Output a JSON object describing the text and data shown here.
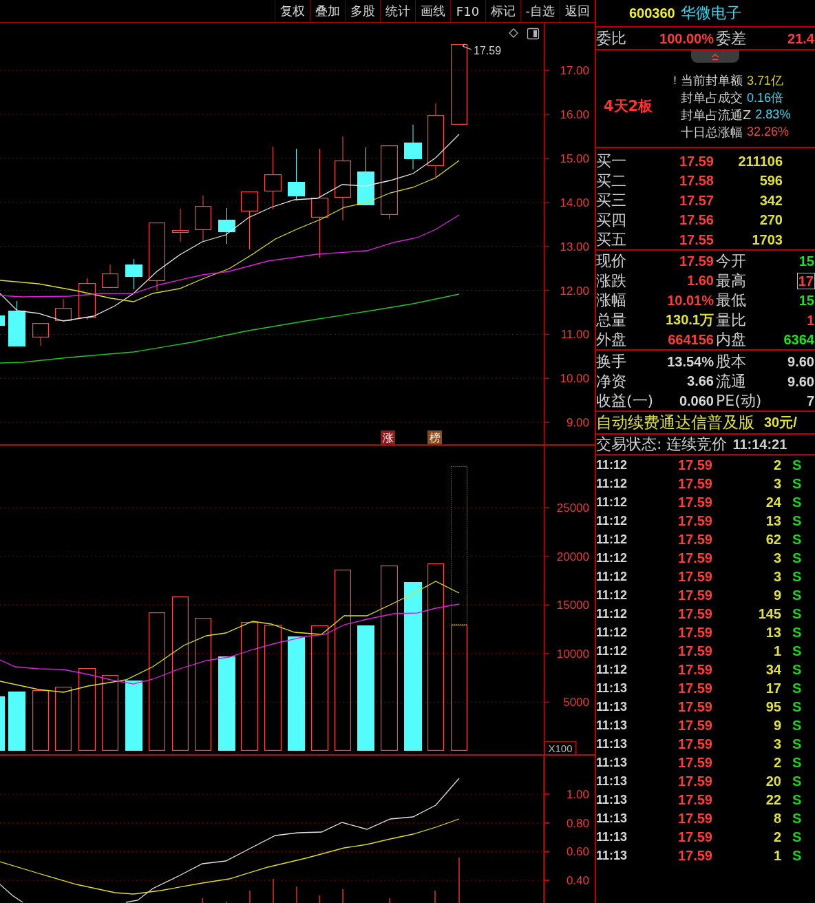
{
  "toolbar": {
    "buttons": [
      "复权",
      "叠加",
      "多股",
      "统计",
      "画线",
      "F10",
      "标记",
      "-自选",
      "返回"
    ]
  },
  "price_chart": {
    "axis_labels": [
      "17.00",
      "16.00",
      "15.00",
      "14.00",
      "13.00",
      "12.00",
      "11.00",
      "10.00",
      "9.00"
    ],
    "last_price": "17.59",
    "markers": [
      {
        "label": "涨",
        "color": "#8e1c1c"
      },
      {
        "label": "榜",
        "color": "#8c4c1c"
      }
    ]
  },
  "volume_chart": {
    "axis_labels": [
      "25000",
      "20000",
      "15000",
      "10000",
      "5000"
    ],
    "unit": "X100"
  },
  "indicator_chart": {
    "axis_labels": [
      "1.00",
      "0.80",
      "0.60",
      "0.40"
    ]
  },
  "quote_panel": {
    "header": {
      "code": "600360",
      "name": "华微电子"
    },
    "commission": {
      "left": {
        "label": "委比",
        "value": "100.00%"
      },
      "right": {
        "label": "委差",
        "value": "21.4"
      }
    },
    "seal": {
      "streak": "4天2板",
      "lines": [
        {
          "label": "当前封单额",
          "value": "3.71亿",
          "color": "#d8d040",
          "marked": true
        },
        {
          "label": "封单占成交",
          "value": "0.16倍",
          "color": "#40d8f0",
          "marked": false
        },
        {
          "label": "封单占流通Z",
          "value": "2.83%",
          "color": "#40d8f0",
          "marked": false
        },
        {
          "label": "十日总涨幅",
          "value": "32.26%",
          "color": "#f04848",
          "marked": false
        }
      ]
    },
    "bids": [
      {
        "label": "买一",
        "price": "17.59",
        "volume": "211106"
      },
      {
        "label": "买二",
        "price": "17.58",
        "volume": "596"
      },
      {
        "label": "买三",
        "price": "17.57",
        "volume": "342"
      },
      {
        "label": "买四",
        "price": "17.56",
        "volume": "270"
      },
      {
        "label": "买五",
        "price": "17.55",
        "volume": "1703"
      }
    ],
    "quote": [
      {
        "left": {
          "label": "现价",
          "value": "17.59",
          "color": "#ff3c3c"
        },
        "right": {
          "label": "今开",
          "value": "15",
          "color": "#20e020",
          "boxed": false
        }
      },
      {
        "left": {
          "label": "涨跌",
          "value": "1.60",
          "color": "#ff3c3c"
        },
        "right": {
          "label": "最高",
          "value": "17",
          "color": "#ff3c3c",
          "boxed": true
        }
      },
      {
        "left": {
          "label": "涨幅",
          "value": "10.01%",
          "color": "#ff3c3c"
        },
        "right": {
          "label": "最低",
          "value": "15",
          "color": "#20e020",
          "boxed": false
        }
      },
      {
        "left": {
          "label": "总量",
          "value": "130.1万",
          "color": "#e0e040"
        },
        "right": {
          "label": "量比",
          "value": "1",
          "color": "#ff3c3c",
          "boxed": false
        }
      },
      {
        "left": {
          "label": "外盘",
          "value": "664156",
          "color": "#ff3c3c"
        },
        "right": {
          "label": "内盘",
          "value": "6364",
          "color": "#20e020",
          "boxed": false
        }
      }
    ],
    "fundamentals": [
      {
        "left": {
          "label": "换手",
          "value": "13.54%"
        },
        "right": {
          "label": "股本",
          "value": "9.60"
        }
      },
      {
        "left": {
          "label": "净资",
          "value": "3.66"
        },
        "right": {
          "label": "流通",
          "value": "9.60"
        }
      },
      {
        "left": {
          "label": "收益(一)",
          "value": "0.060"
        },
        "right": {
          "label": "PE(动)",
          "value": "7"
        }
      }
    ],
    "promo": {
      "text": "自动续费通达信普及版",
      "price": "30元/"
    },
    "status": {
      "text": "交易状态: 连续竞价",
      "time": "11:14:21"
    },
    "ticks": [
      {
        "time": "11:12",
        "price": "17.59",
        "volume": "2",
        "side": "S"
      },
      {
        "time": "11:12",
        "price": "17.59",
        "volume": "3",
        "side": "S"
      },
      {
        "time": "11:12",
        "price": "17.59",
        "volume": "24",
        "side": "S"
      },
      {
        "time": "11:12",
        "price": "17.59",
        "volume": "13",
        "side": "S"
      },
      {
        "time": "11:12",
        "price": "17.59",
        "volume": "62",
        "side": "S"
      },
      {
        "time": "11:12",
        "price": "17.59",
        "volume": "3",
        "side": "S"
      },
      {
        "time": "11:12",
        "price": "17.59",
        "volume": "3",
        "side": "S"
      },
      {
        "time": "11:12",
        "price": "17.59",
        "volume": "9",
        "side": "S"
      },
      {
        "time": "11:12",
        "price": "17.59",
        "volume": "145",
        "side": "S"
      },
      {
        "time": "11:12",
        "price": "17.59",
        "volume": "13",
        "side": "S"
      },
      {
        "time": "11:12",
        "price": "17.59",
        "volume": "1",
        "side": "S"
      },
      {
        "time": "11:12",
        "price": "17.59",
        "volume": "34",
        "side": "S"
      },
      {
        "time": "11:13",
        "price": "17.59",
        "volume": "17",
        "side": "S"
      },
      {
        "time": "11:13",
        "price": "17.59",
        "volume": "95",
        "side": "S"
      },
      {
        "time": "11:13",
        "price": "17.59",
        "volume": "9",
        "side": "S"
      },
      {
        "time": "11:13",
        "price": "17.59",
        "volume": "3",
        "side": "S"
      },
      {
        "time": "11:13",
        "price": "17.59",
        "volume": "2",
        "side": "S"
      },
      {
        "time": "11:13",
        "price": "17.59",
        "volume": "20",
        "side": "S"
      },
      {
        "time": "11:13",
        "price": "17.59",
        "volume": "22",
        "side": "S"
      },
      {
        "time": "11:13",
        "price": "17.59",
        "volume": "8",
        "side": "S"
      },
      {
        "time": "11:13",
        "price": "17.59",
        "volume": "2",
        "side": "S"
      },
      {
        "time": "11:13",
        "price": "17.59",
        "volume": "1",
        "side": "S"
      }
    ]
  }
}
